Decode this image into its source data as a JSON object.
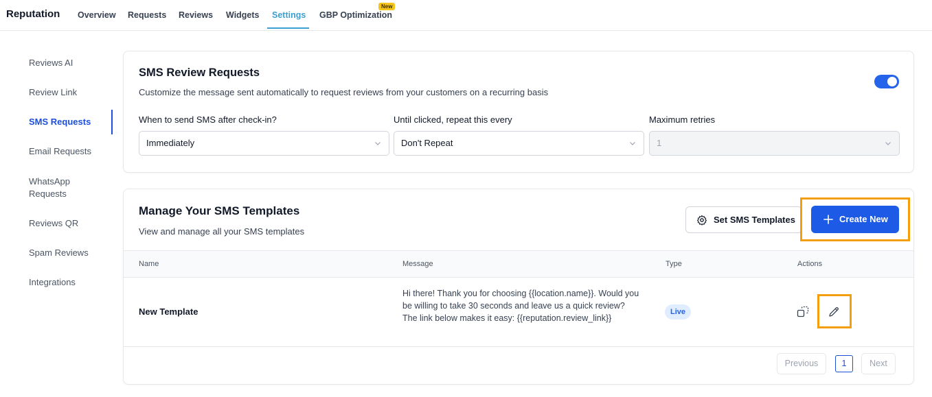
{
  "app": {
    "title": "Reputation"
  },
  "nav": {
    "tabs": [
      {
        "label": "Overview"
      },
      {
        "label": "Requests"
      },
      {
        "label": "Reviews"
      },
      {
        "label": "Widgets"
      },
      {
        "label": "Settings"
      },
      {
        "label": "GBP Optimization"
      }
    ],
    "active": "Settings",
    "new_badge": "New"
  },
  "sidebar": {
    "items": [
      {
        "label": "Reviews AI"
      },
      {
        "label": "Review Link"
      },
      {
        "label": "SMS Requests"
      },
      {
        "label": "Email Requests"
      },
      {
        "label": "WhatsApp Requests"
      },
      {
        "label": "Reviews QR"
      },
      {
        "label": "Spam Reviews"
      },
      {
        "label": "Integrations"
      }
    ],
    "active": "SMS Requests"
  },
  "sms_requests": {
    "title": "SMS Review Requests",
    "subtitle": "Customize the message sent automatically to request reviews from your customers on a recurring basis",
    "enabled": true,
    "fields": {
      "when_label": "When to send SMS after check-in?",
      "when_value": "Immediately",
      "repeat_label": "Until clicked, repeat this every",
      "repeat_value": "Don't Repeat",
      "retries_label": "Maximum retries",
      "retries_value": "1"
    }
  },
  "templates": {
    "title": "Manage Your SMS Templates",
    "subtitle": "View and manage all your SMS templates",
    "set_button": "Set SMS Templates",
    "create_button": "Create New",
    "columns": [
      "Name",
      "Message",
      "Type",
      "Actions"
    ],
    "rows": [
      {
        "name": "New Template",
        "message": "Hi there! Thank you for choosing {{location.name}}. Would you be willing to take 30 seconds and leave us a quick review? The link below makes it easy: {{reputation.review_link}}",
        "type": "Live"
      }
    ],
    "pagination": {
      "previous": "Previous",
      "page": "1",
      "next": "Next"
    }
  },
  "colors": {
    "accent_nav": "#3b9fd1",
    "primary": "#1d5ae6",
    "highlight": "#f59e0b",
    "badge_new": "#f5c51b"
  }
}
